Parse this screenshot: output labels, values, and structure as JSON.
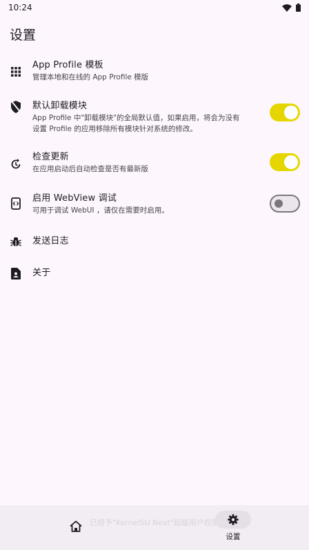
{
  "status": {
    "time": "10:24"
  },
  "page_title": "设置",
  "items": [
    {
      "title": "App Profile 模板",
      "subtitle": "管理本地和在线的 App Profile 模版",
      "icon": "grid-icon"
    },
    {
      "title": "默认卸载模块",
      "subtitle_line1": "App Profile 中\"卸载模块\"的全局默认值，如果启用，将会为没有",
      "subtitle_line2": "设置 Profile 的应用移除所有模块针对系统的修改。",
      "icon": "shield-off-icon",
      "toggle": true
    },
    {
      "title": "检查更新",
      "subtitle": "在应用启动后自动检查是否有最新版",
      "icon": "update-icon",
      "toggle": true
    },
    {
      "title": "启用 WebView 调试",
      "subtitle": "可用于调试 WebUI ，请仅在需要时启用。",
      "icon": "webview-icon",
      "toggle": false
    },
    {
      "title": "发送日志",
      "icon": "bug-icon"
    },
    {
      "title": "关于",
      "icon": "contact-file-icon"
    }
  ],
  "bottom_nav": {
    "toast": "已授予\"KernelSU Next\"超级用户权限",
    "settings_label": "设置",
    "icons": [
      "home-icon",
      "gear-icon"
    ]
  },
  "colors": {
    "toggle_on": "#e5d600",
    "background": "#fdf7fd"
  }
}
